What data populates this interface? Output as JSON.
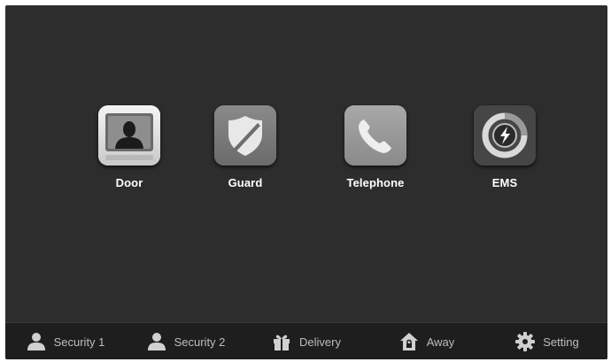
{
  "apps": [
    {
      "label": "Door",
      "icon": "door-camera-icon"
    },
    {
      "label": "Guard",
      "icon": "shield-icon"
    },
    {
      "label": "Telephone",
      "icon": "phone-icon"
    },
    {
      "label": "EMS",
      "icon": "lightning-gauge-icon"
    }
  ],
  "bottom_nav": [
    {
      "label": "Security 1",
      "icon": "person-icon"
    },
    {
      "label": "Security 2",
      "icon": "person-icon"
    },
    {
      "label": "Delivery",
      "icon": "gift-icon"
    },
    {
      "label": "Away",
      "icon": "house-lock-icon"
    },
    {
      "label": "Setting",
      "icon": "gear-icon"
    }
  ],
  "colors": {
    "screen_bg": "#2d2d2d",
    "bottom_bar_bg": "#1e1e1e",
    "label_text": "#ffffff",
    "nav_text": "#bdbdbd"
  }
}
